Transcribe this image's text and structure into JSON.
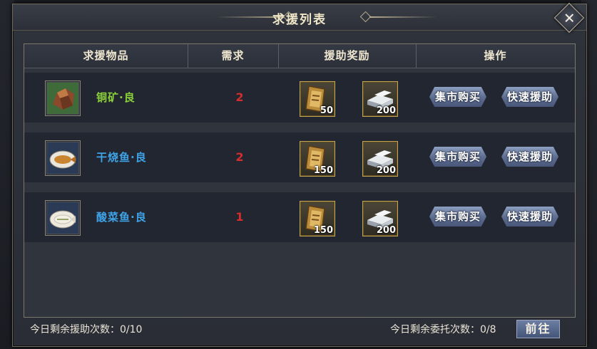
{
  "dialog": {
    "title": "求援列表",
    "close_icon": "close-icon"
  },
  "table": {
    "headers": [
      "求援物品",
      "需求",
      "援助奖励",
      "操作"
    ],
    "rows": [
      {
        "item": "铜矿·良",
        "item_color": "#8bd13a",
        "item_icon": "copper-ore-icon",
        "need": "2",
        "rewards": [
          {
            "icon": "token-scroll-icon",
            "qty": "50"
          },
          {
            "icon": "silver-ingot-icon",
            "qty": "200"
          }
        ],
        "btn_market": "集市购买",
        "btn_quick": "快速援助"
      },
      {
        "item": "干烧鱼·良",
        "item_color": "#3fa3e8",
        "item_icon": "braised-fish-icon",
        "need": "2",
        "rewards": [
          {
            "icon": "token-scroll-icon",
            "qty": "150"
          },
          {
            "icon": "silver-ingot-icon",
            "qty": "200"
          }
        ],
        "btn_market": "集市购买",
        "btn_quick": "快速援助"
      },
      {
        "item": "酸菜鱼·良",
        "item_color": "#3fa3e8",
        "item_icon": "pickled-fish-icon",
        "need": "1",
        "rewards": [
          {
            "icon": "token-scroll-icon",
            "qty": "150"
          },
          {
            "icon": "silver-ingot-icon",
            "qty": "200"
          }
        ],
        "btn_market": "集市购买",
        "btn_quick": "快速援助"
      }
    ]
  },
  "footer": {
    "assist_left": "今日剩余援助次数：0/10",
    "entrust_left": "今日剩余委托次数：0/8",
    "go_button": "前往"
  }
}
